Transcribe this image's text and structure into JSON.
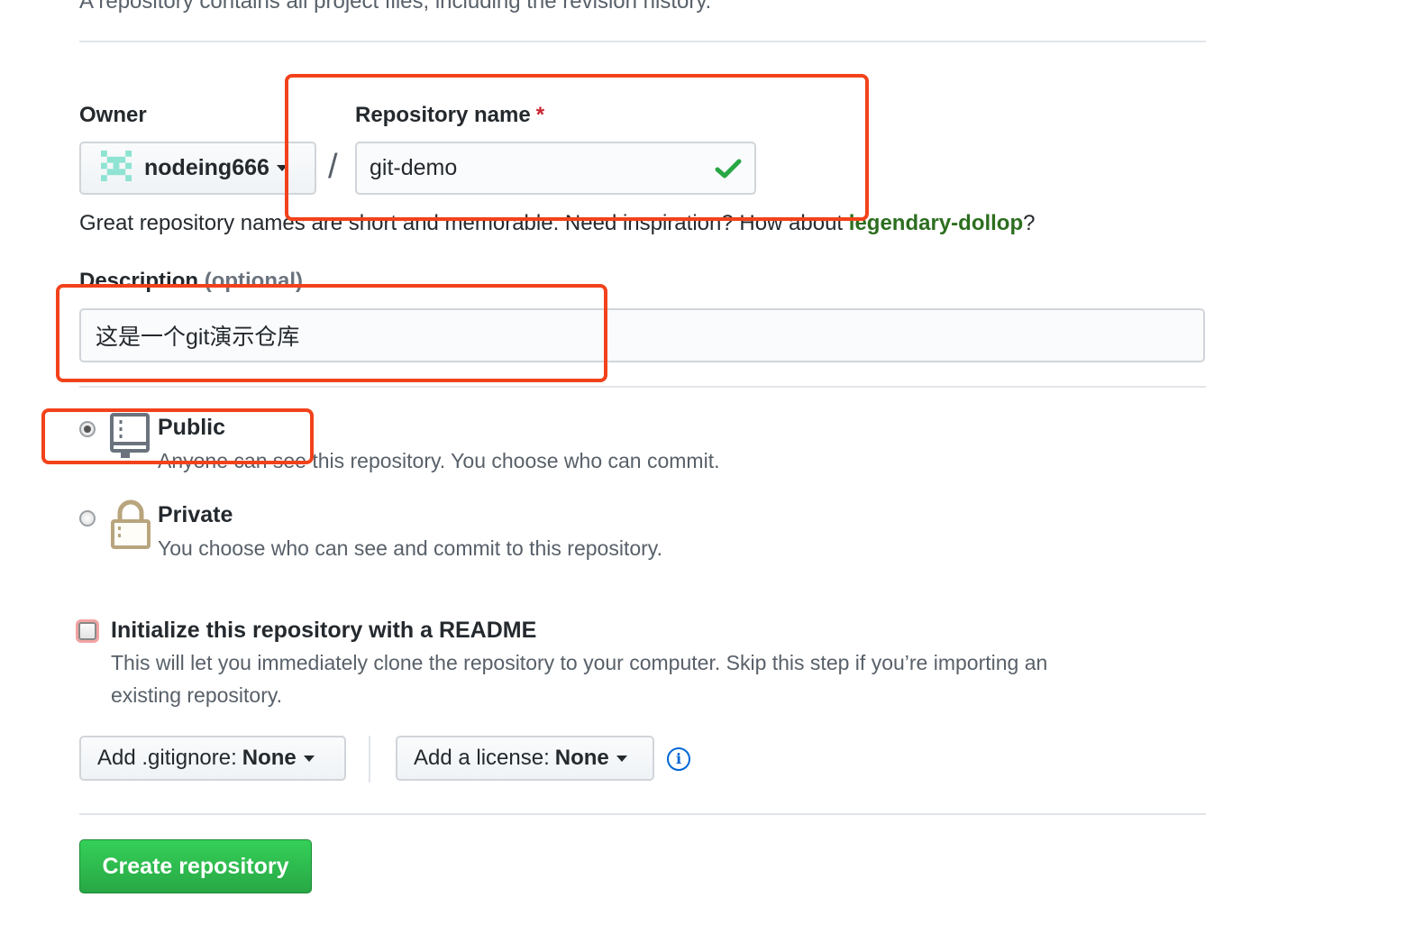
{
  "intro_text": "A repository contains all project files, including the revision history.",
  "owner": {
    "label": "Owner",
    "name": "nodeing666",
    "avatar_icon": "identicon-avatar"
  },
  "separator": "/",
  "repo_name": {
    "label": "Repository name",
    "required_marker": "*",
    "value": "git-demo",
    "valid_icon": "check-icon"
  },
  "name_hint": {
    "text": "Great repository names are short and memorable. Need inspiration? How about ",
    "suggestion": "legendary-dollop",
    "suffix": "?"
  },
  "description": {
    "label": "Description",
    "optional": "(optional)",
    "value": "这是一个git演示仓库"
  },
  "visibility": {
    "public": {
      "title": "Public",
      "desc": "Anyone can see this repository. You choose who can commit.",
      "icon": "repo-icon",
      "selected": true
    },
    "private": {
      "title": "Private",
      "desc": "You choose who can see and commit to this repository.",
      "icon": "lock-icon",
      "selected": false
    }
  },
  "readme": {
    "title": "Initialize this repository with a README",
    "desc_line1": "This will let you immediately clone the repository to your computer. Skip this step if you’re importing an",
    "desc_line2": "existing repository.",
    "checked": false
  },
  "gitignore": {
    "label": "Add .gitignore:",
    "value": "None"
  },
  "license": {
    "label": "Add a license:",
    "value": "None"
  },
  "info_icon": "info-icon",
  "submit": {
    "label": "Create repository"
  },
  "colors": {
    "accent_green": "#28a745",
    "annotation_red": "#f2421b",
    "suggestion_green": "#2c6e1f"
  }
}
